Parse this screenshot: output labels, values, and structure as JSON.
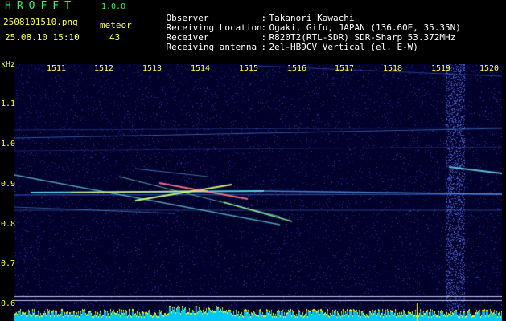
{
  "header": {
    "app_title": "HROFFT",
    "version": "1.0.0",
    "filename": "2508101510.png",
    "meteor_label": "meteor",
    "datetime": "25.08.10 15:10",
    "meteor_count": "43"
  },
  "info": [
    {
      "key": "Observer",
      "value": "Takanori Kawachi"
    },
    {
      "key": "Receiving Location",
      "value": "Ogaki, Gifu, JAPAN (136.60E, 35.35N)"
    },
    {
      "key": "Receiver",
      "value": "R820T2(RTL-SDR) SDR-Sharp 53.372MHz"
    },
    {
      "key": "Receiving antenna",
      "value": "2el-HB9CV Vertical (el. E-W)"
    }
  ],
  "axes": {
    "y_unit": "kHz",
    "y_ticks": [
      "1.1",
      "1.0",
      "0.9",
      "0.8",
      "0.7",
      "0.6"
    ],
    "x_ticks": [
      "1511",
      "1512",
      "1513",
      "1514",
      "1515",
      "1516",
      "1517",
      "1518",
      "1519",
      "1520"
    ]
  },
  "colors": {
    "background": "#00002a",
    "text_yellow": "#ffff40",
    "text_green": "#22ff55",
    "histogram": "#00c8ff",
    "histogram_top": "#ffff00"
  }
}
